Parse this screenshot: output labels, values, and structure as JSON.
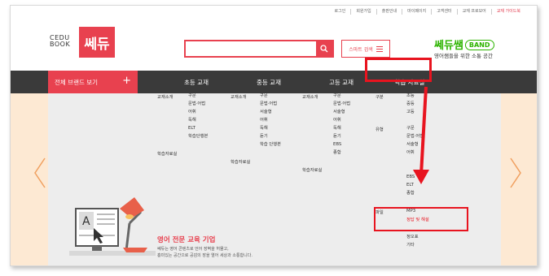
{
  "util_links": [
    "로그인",
    "회원가입",
    "출판안내",
    "마이페이지",
    "고객센터",
    "교재 프로모어",
    "교재 가이드북"
  ],
  "logo": {
    "cedu_line1": "CEDU",
    "cedu_line2": "BOOK",
    "brand": "쎄듀"
  },
  "search": {
    "value": "",
    "placeholder": "",
    "smart_label": "스마트 검색"
  },
  "band": {
    "title": "쎄듀쌤",
    "pill": "BAND",
    "sub": "영어쌤들을 위한 소통 공간"
  },
  "nav": {
    "brand_label": "전체 브랜드 보기",
    "items": [
      "초등 교재",
      "중등 교재",
      "고등 교재",
      "학습 자료실"
    ]
  },
  "columns": {
    "c1": {
      "label": "교재소개",
      "items": [
        "구문",
        "문법·어법",
        "어휘",
        "독해",
        "ELT",
        "학습단행본"
      ],
      "label2": "학습자료실"
    },
    "c2": {
      "label": "교재소개",
      "items": [
        "구문",
        "문법·어법",
        "서술형",
        "어휘",
        "독해",
        "듣기",
        "학습 단행본"
      ],
      "label2": "학습자료실"
    },
    "c3": {
      "label": "교재소개",
      "items": [
        "구문",
        "문법·어법",
        "서술형",
        "어휘",
        "독해",
        "듣기",
        "EBS",
        "종합"
      ],
      "label2": "학습자료실"
    },
    "c4": {
      "label_a": "구분",
      "items_a": [
        "초등",
        "중등",
        "고등"
      ],
      "label_b": "유형",
      "items_b": [
        "구문",
        "문법·어법",
        "서술형",
        "어휘",
        "",
        "",
        "EBS",
        "ELT",
        "종합"
      ],
      "label_c": "파일",
      "items_c": [
        "MP3",
        "정답 및 해설",
        "",
        "정오표",
        "기타"
      ]
    }
  },
  "promo": {
    "headline": "영어 전문 교육 기업",
    "desc1": "쎄듀는 영어 콘텐츠로 언어 장벽을 허물고,",
    "desc2": "흥미있는 공간으로 공감의 장을 열어 세상과 소통합니다."
  },
  "colors": {
    "brand_red": "#e8414f",
    "band_green": "#2db400",
    "highlight": "#e8141f"
  }
}
